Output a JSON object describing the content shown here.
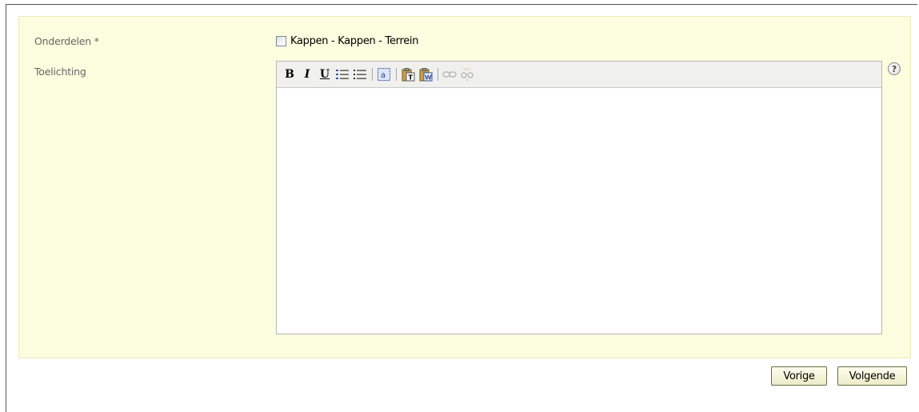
{
  "form": {
    "onderdelen_label": "Onderdelen *",
    "checkbox_label": "Kappen - Kappen - Terrein",
    "checkbox_checked": false,
    "toelichting_label": "Toelichting",
    "toelichting_value": ""
  },
  "toolbar": {
    "bold": "B",
    "italic": "I",
    "underline": "U",
    "icons": [
      "bold-icon",
      "italic-icon",
      "underline-icon",
      "ordered-list-icon",
      "unordered-list-icon",
      "select-all-icon",
      "paste-text-icon",
      "paste-word-icon",
      "link-icon",
      "unlink-icon"
    ]
  },
  "help": {
    "symbol": "?"
  },
  "buttons": {
    "previous_label": "Vorige",
    "next_label": "Volgende"
  },
  "colors": {
    "panel_background": "#fcfcdf",
    "panel_border": "#ecebba",
    "button_border": "#6b6b42"
  }
}
